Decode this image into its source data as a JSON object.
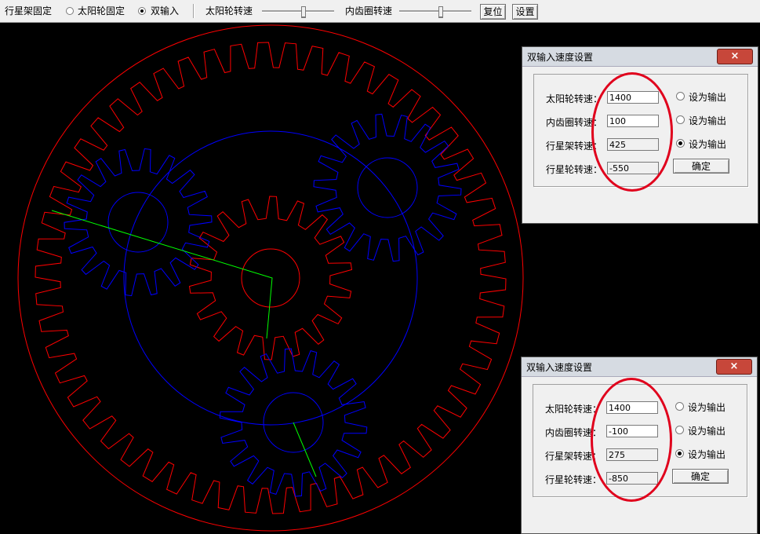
{
  "toolbar": {
    "mode_carrier_fixed": "行星架固定",
    "mode_sun_fixed": "太阳轮固定",
    "mode_dual_input": "双输入",
    "selected_mode": "双输入",
    "sun_speed_label": "太阳轮转速",
    "sun_speed_slider": 0.55,
    "ring_speed_label": "内齿圈转速",
    "ring_speed_slider": 0.55,
    "reset_button": "复位",
    "settings_button": "设置"
  },
  "colors": {
    "ring_gear": "#ff0000",
    "sun_gear": "#ff0000",
    "planet_gears": "#0000ff",
    "carrier_arm": "#00ff00",
    "background": "#000000",
    "highlight": "#e0001c"
  },
  "dialogs": [
    {
      "title": "双输入速度设置",
      "close": "×",
      "sun_label": "太阳轮转速：",
      "sun_value": "1400",
      "ring_label": "内齿圈转速：",
      "ring_value": "100",
      "carrier_label": "行星架转速：",
      "carrier_value": "425",
      "planet_label": "行星轮转速：",
      "planet_value": "-550",
      "opt_sun": "设为输出",
      "opt_ring": "设为输出",
      "opt_carrier": "设为输出",
      "ok": "确定",
      "selected_output": "carrier"
    },
    {
      "title": "双输入速度设置",
      "close": "×",
      "sun_label": "太阳轮转速：",
      "sun_value": "1400",
      "ring_label": "内齿圈转速：",
      "ring_value": "-100",
      "carrier_label": "行星架转速：",
      "carrier_value": "275",
      "planet_label": "行星轮转速：",
      "planet_value": "-850",
      "opt_sun": "设为输出",
      "opt_ring": "设为输出",
      "opt_carrier": "设为输出",
      "ok": "确定",
      "selected_output": "carrier"
    }
  ]
}
